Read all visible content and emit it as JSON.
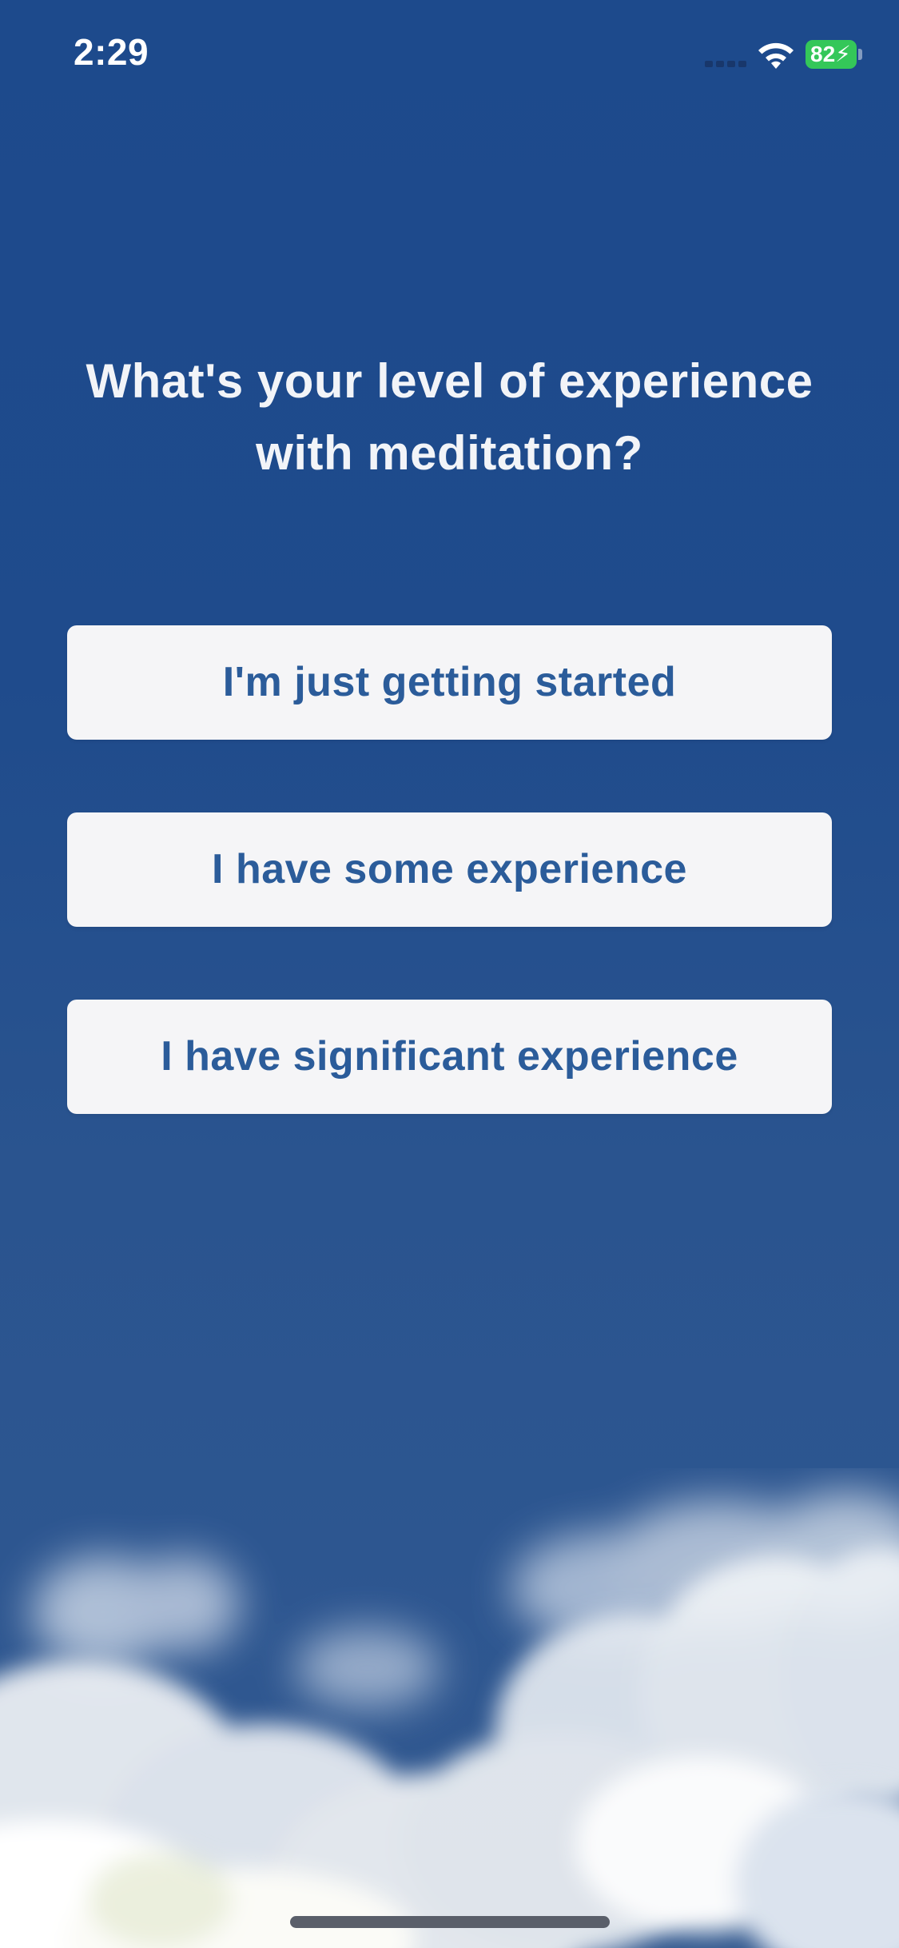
{
  "status_bar": {
    "time": "2:29",
    "battery_level": "82",
    "battery_charging": true,
    "battery_color": "#34c759",
    "icons": [
      "signal-icon",
      "wifi-icon",
      "battery-icon"
    ]
  },
  "question": {
    "title": "What's your level of experience with meditation?"
  },
  "options": [
    {
      "label": "I'm just getting started"
    },
    {
      "label": "I have some experience"
    },
    {
      "label": "I have significant experience"
    }
  ],
  "theme": {
    "background": "#1f4b8c",
    "button_bg": "#f5f5f7",
    "button_text": "#2b5c9a",
    "title_text": "#f2f4f8"
  }
}
